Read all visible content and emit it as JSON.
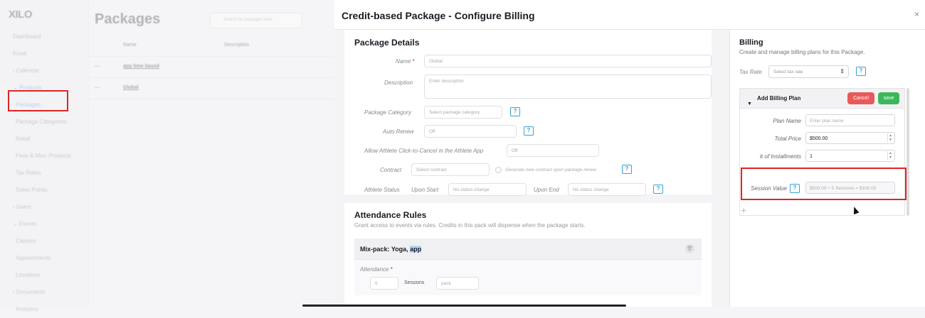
{
  "background": {
    "logo": "XILO",
    "nav": [
      {
        "label": "Dashboard",
        "level": "item"
      },
      {
        "label": "Kiosk",
        "level": "item"
      },
      {
        "label": "› Calendar",
        "level": "section"
      },
      {
        "label": "⌄ Products",
        "level": "section",
        "active": true
      },
      {
        "label": "Packages",
        "level": "sub",
        "active": true
      },
      {
        "label": "Package Categories",
        "level": "sub"
      },
      {
        "label": "Retail",
        "level": "sub"
      },
      {
        "label": "Fees & Misc Products",
        "level": "sub"
      },
      {
        "label": "Tax Rates",
        "level": "sub"
      },
      {
        "label": "Sales Points",
        "level": "sub"
      },
      {
        "label": "› Users",
        "level": "section"
      },
      {
        "label": "⌄ Events",
        "level": "section"
      },
      {
        "label": "Classes",
        "level": "sub"
      },
      {
        "label": "Appointments",
        "level": "sub"
      },
      {
        "label": "Locations",
        "level": "sub"
      },
      {
        "label": "› Documents",
        "level": "section"
      },
      {
        "label": "Analytics",
        "level": "sub"
      }
    ],
    "title": "Packages",
    "search_placeholder": "Search for packages here",
    "columns": [
      "Name",
      "Description"
    ],
    "rows": [
      {
        "name": "app time based",
        "desc": ""
      },
      {
        "name": "Global",
        "desc": ""
      }
    ]
  },
  "modal": {
    "title": "Credit-based Package - Configure Billing",
    "close": "×",
    "package_details": {
      "title": "Package Details",
      "name_label": "Name",
      "required_mark": "*",
      "name_value": "Global",
      "description_label": "Description",
      "description_placeholder": "Enter description",
      "category_label": "Package Category",
      "category_placeholder": "Select package category",
      "auto_renew_label": "Auto Renew",
      "auto_renew_value": "Off",
      "cancel_label": "Allow Athlete Click-to-Cancel in the Athlete App",
      "cancel_value": "Off",
      "contract_label": "Contract",
      "contract_placeholder": "Select contract",
      "generate_contract_label": "Generate new contract upon package renew",
      "athlete_status_label": "Athlete Status",
      "upon_start_label": "Upon Start",
      "upon_start_value": "No status change",
      "upon_end_label": "Upon End",
      "upon_end_value": "No status change",
      "help_glyph": "?"
    },
    "attendance_rules": {
      "title": "Attendance Rules",
      "subtitle": "Grant access to events via rules. Credits in this pack will dispense when the package starts.",
      "rule_title_prefix": "Mix-pack: Yoga, ",
      "rule_title_selected": "app",
      "attendance_label": "Attendance",
      "sessions_value": "5",
      "sessions_label": "Sessions",
      "per_value": "pack",
      "next_label": "5 Sessions"
    },
    "billing": {
      "title": "Billing",
      "subtitle": "Create and manage billing plans for this Package.",
      "tax_rate_label": "Tax Rate",
      "tax_rate_placeholder": "Select tax rate",
      "plan": {
        "title": "Add Billing Plan",
        "cancel_label": "Cancel",
        "save_label": "save",
        "plan_name_label": "Plan Name",
        "plan_name_placeholder": "Enter plan name",
        "total_price_label": "Total Price",
        "total_price_value": "$500.00",
        "installments_label": "# of Installments",
        "installments_value": "1",
        "session_value_label": "Session Value",
        "session_value_calc": "$500.00 ÷ 5 Sessions = $100.00"
      },
      "add_glyph": "+"
    }
  }
}
